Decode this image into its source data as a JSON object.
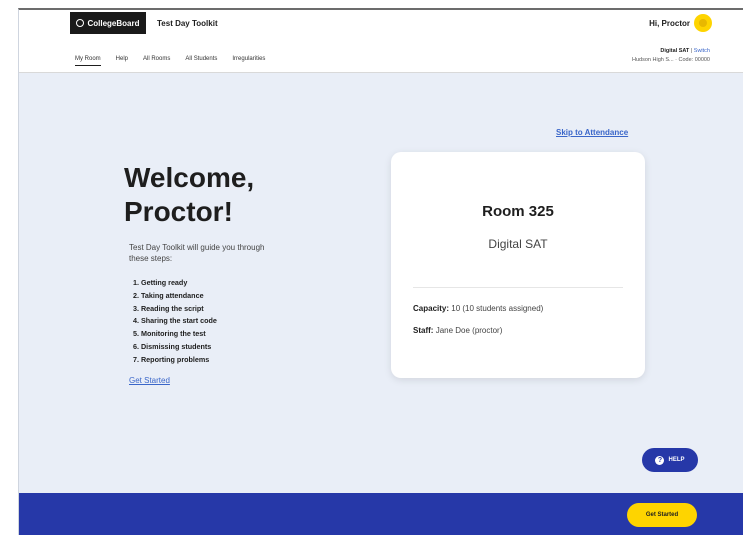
{
  "header": {
    "logo_text": "CollegeBoard",
    "app_title": "Test Day Toolkit",
    "greeting": "Hi, Proctor",
    "brand_color": "#1a1a1a",
    "avatar_color": "#fed400"
  },
  "nav": {
    "items": [
      "My Room",
      "Help",
      "All Rooms",
      "All Students",
      "Irregularities"
    ],
    "active": "My Room"
  },
  "room_info": {
    "test": "Digital SAT",
    "switch_link": "Switch",
    "school_line": "Hudson High S... · Code: 00000"
  },
  "main": {
    "skip_link": "Skip to Attendance",
    "welcome_line1": "Welcome,",
    "welcome_line2": "Proctor!",
    "intro": "Test Day Toolkit will guide you through these steps:",
    "steps": [
      "1. Getting ready",
      "2. Taking attendance",
      "3. Reading the script",
      "4. Sharing the start code",
      "5. Monitoring the test",
      "6. Dismissing students",
      "7. Reporting problems"
    ],
    "get_started_link": "Get Started"
  },
  "card": {
    "room": "Room 325",
    "exam": "Digital SAT",
    "capacity_label": "Capacity:",
    "capacity_value": "10 (10 students assigned)",
    "staff_label": "Staff:",
    "staff_value": "Jane Doe (proctor)"
  },
  "help_button": {
    "label": "HELP",
    "icon": "question-icon"
  },
  "footer": {
    "button_label": "Get Started",
    "bar_color": "#2638a8",
    "button_color": "#fed400"
  }
}
